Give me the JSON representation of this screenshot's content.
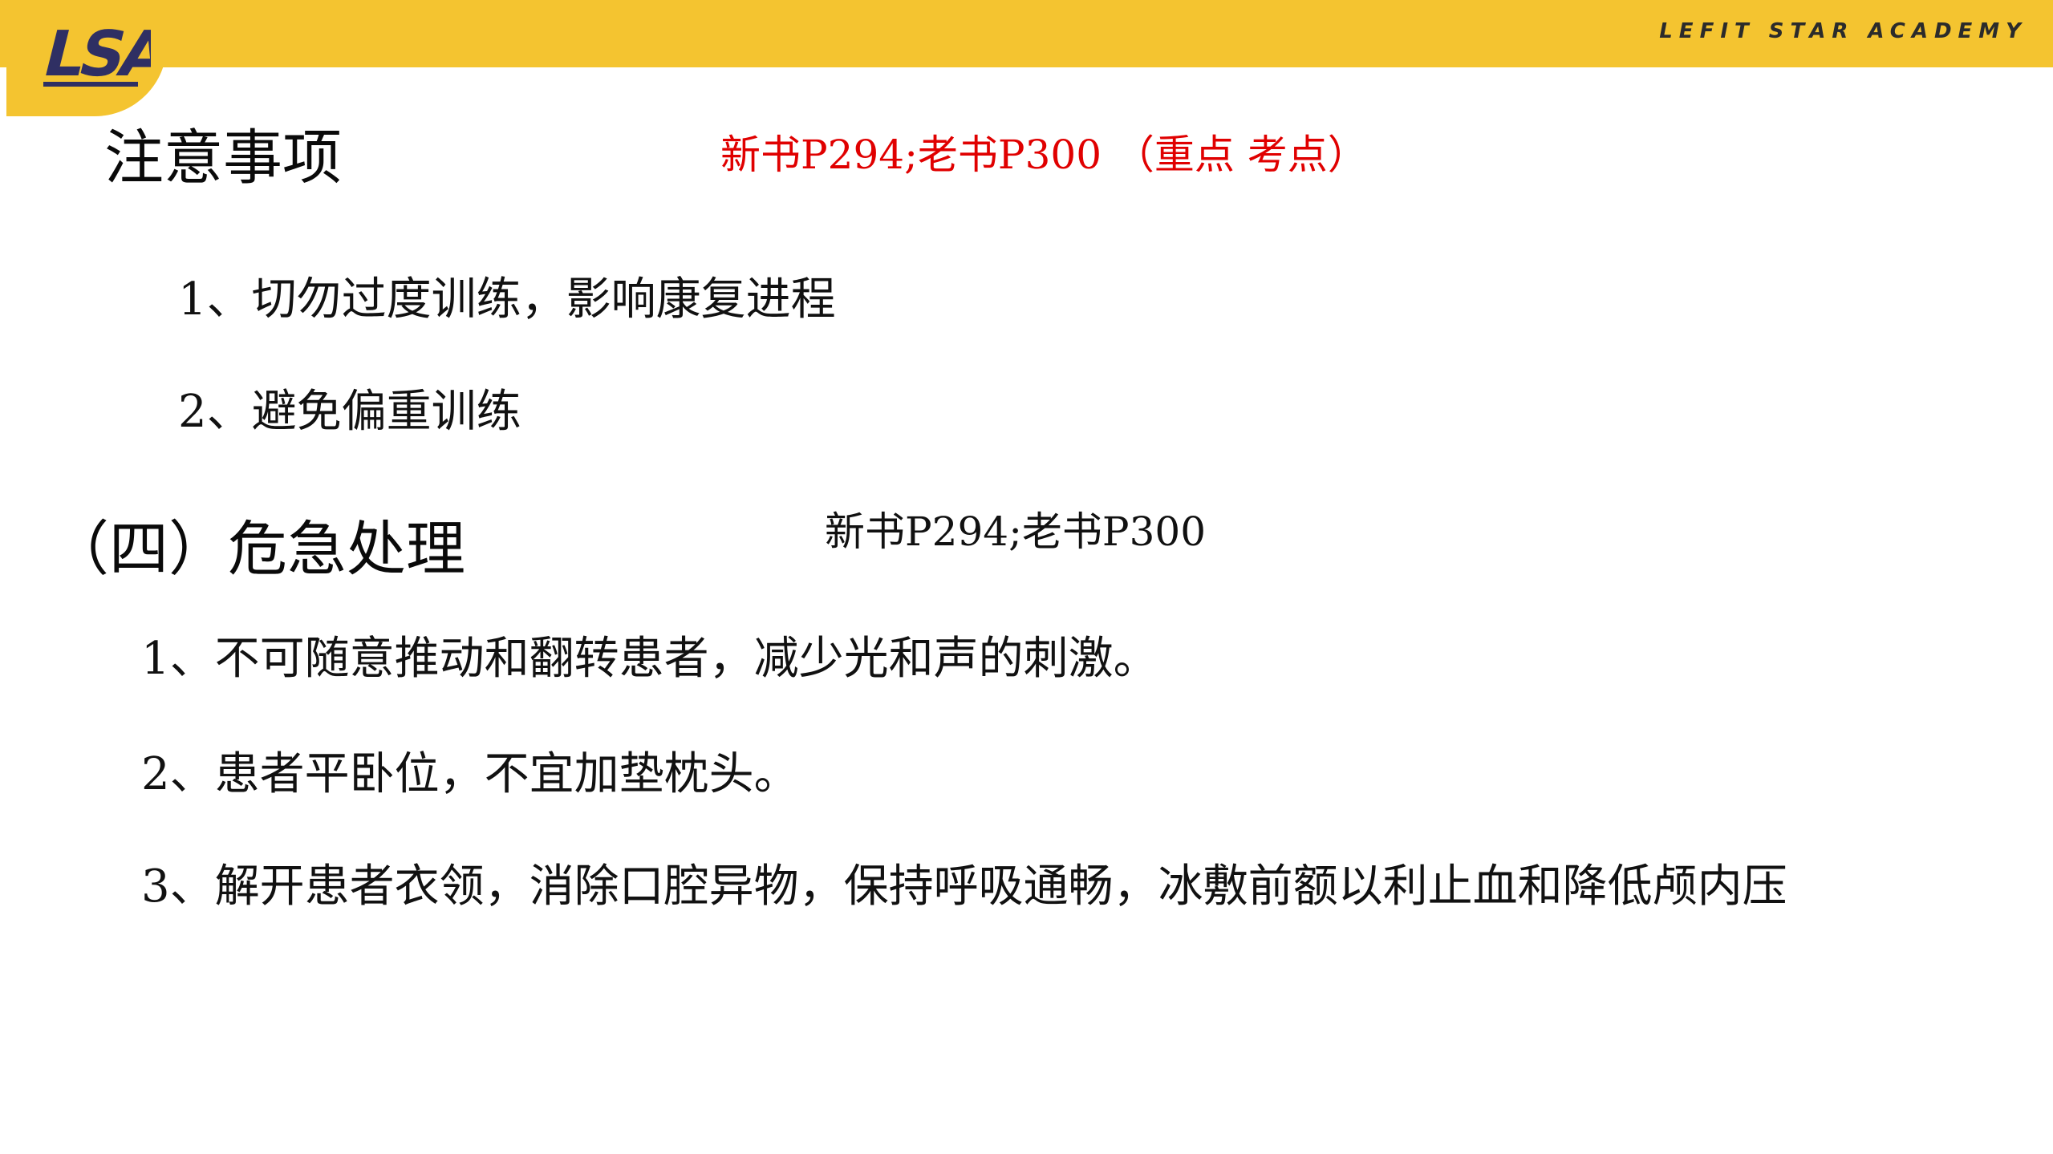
{
  "header": {
    "logo_text": "LSA",
    "brand": "LEFIT STAR ACADEMY",
    "bar_color": "#f4c430",
    "logo_color": "#2f2f63"
  },
  "section1": {
    "title": "注意事项",
    "reference": "新书P294;老书P300 （重点 考点）",
    "reference_color": "#e00000",
    "items": [
      "1、切勿过度训练，影响康复进程",
      "2、避免偏重训练"
    ]
  },
  "section2": {
    "title": "（四）危急处理",
    "reference": "新书P294;老书P300",
    "items": [
      "1、不可随意推动和翻转患者，减少光和声的刺激。",
      "2、患者平卧位，不宜加垫枕头。",
      "3、解开患者衣领，消除口腔异物，保持呼吸通畅，冰敷前额以利止血和降低颅内压"
    ]
  }
}
